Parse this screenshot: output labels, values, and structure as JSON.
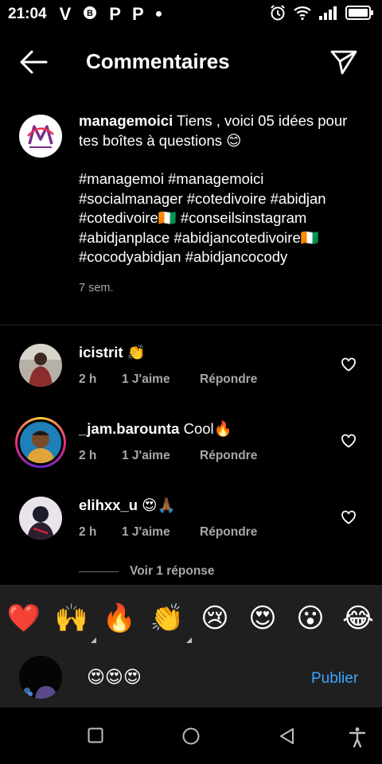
{
  "status_bar": {
    "time": "21:04",
    "left_icons": [
      "V",
      "vpn-icon",
      "P",
      "P",
      "•"
    ]
  },
  "header": {
    "title": "Commentaires"
  },
  "caption": {
    "username": "managemoici",
    "text": " Tiens , voici 05 idées pour tes boîtes à questions 😊",
    "hashtags": "#managemoi #managemoici #socialmanager #cotedivoire #abidjan #cotedivoire🇨🇮 #conseilsinstagram #abidjanplace #abidjancotedivoire🇨🇮 #cocodyabidjan #abidjancocody",
    "time": "7 sem."
  },
  "comments": [
    {
      "username": "icistrit",
      "text": " 👏",
      "time": "2 h",
      "likes": "1 J'aime",
      "reply": "Répondre"
    },
    {
      "username": "_jam.barounta",
      "text": " Cool🔥",
      "time": "2 h",
      "likes": "1 J'aime",
      "reply": "Répondre"
    },
    {
      "username": "elihxx_u",
      "text": " 😍🙏🏾",
      "time": "2 h",
      "likes": "1 J'aime",
      "reply": "Répondre"
    }
  ],
  "replies": {
    "label": "Voir 1 réponse"
  },
  "emoji_bar": [
    "❤️",
    "🙌",
    "🔥",
    "👏",
    "😢",
    "😍",
    "😮",
    "😂"
  ],
  "composer": {
    "value": "😍😍😍",
    "publish_label": "Publier"
  },
  "colors": {
    "background": "#000000",
    "panel": "#1f1f1f",
    "accent": "#3ea6ff",
    "muted_text": "#a8a8a8"
  }
}
